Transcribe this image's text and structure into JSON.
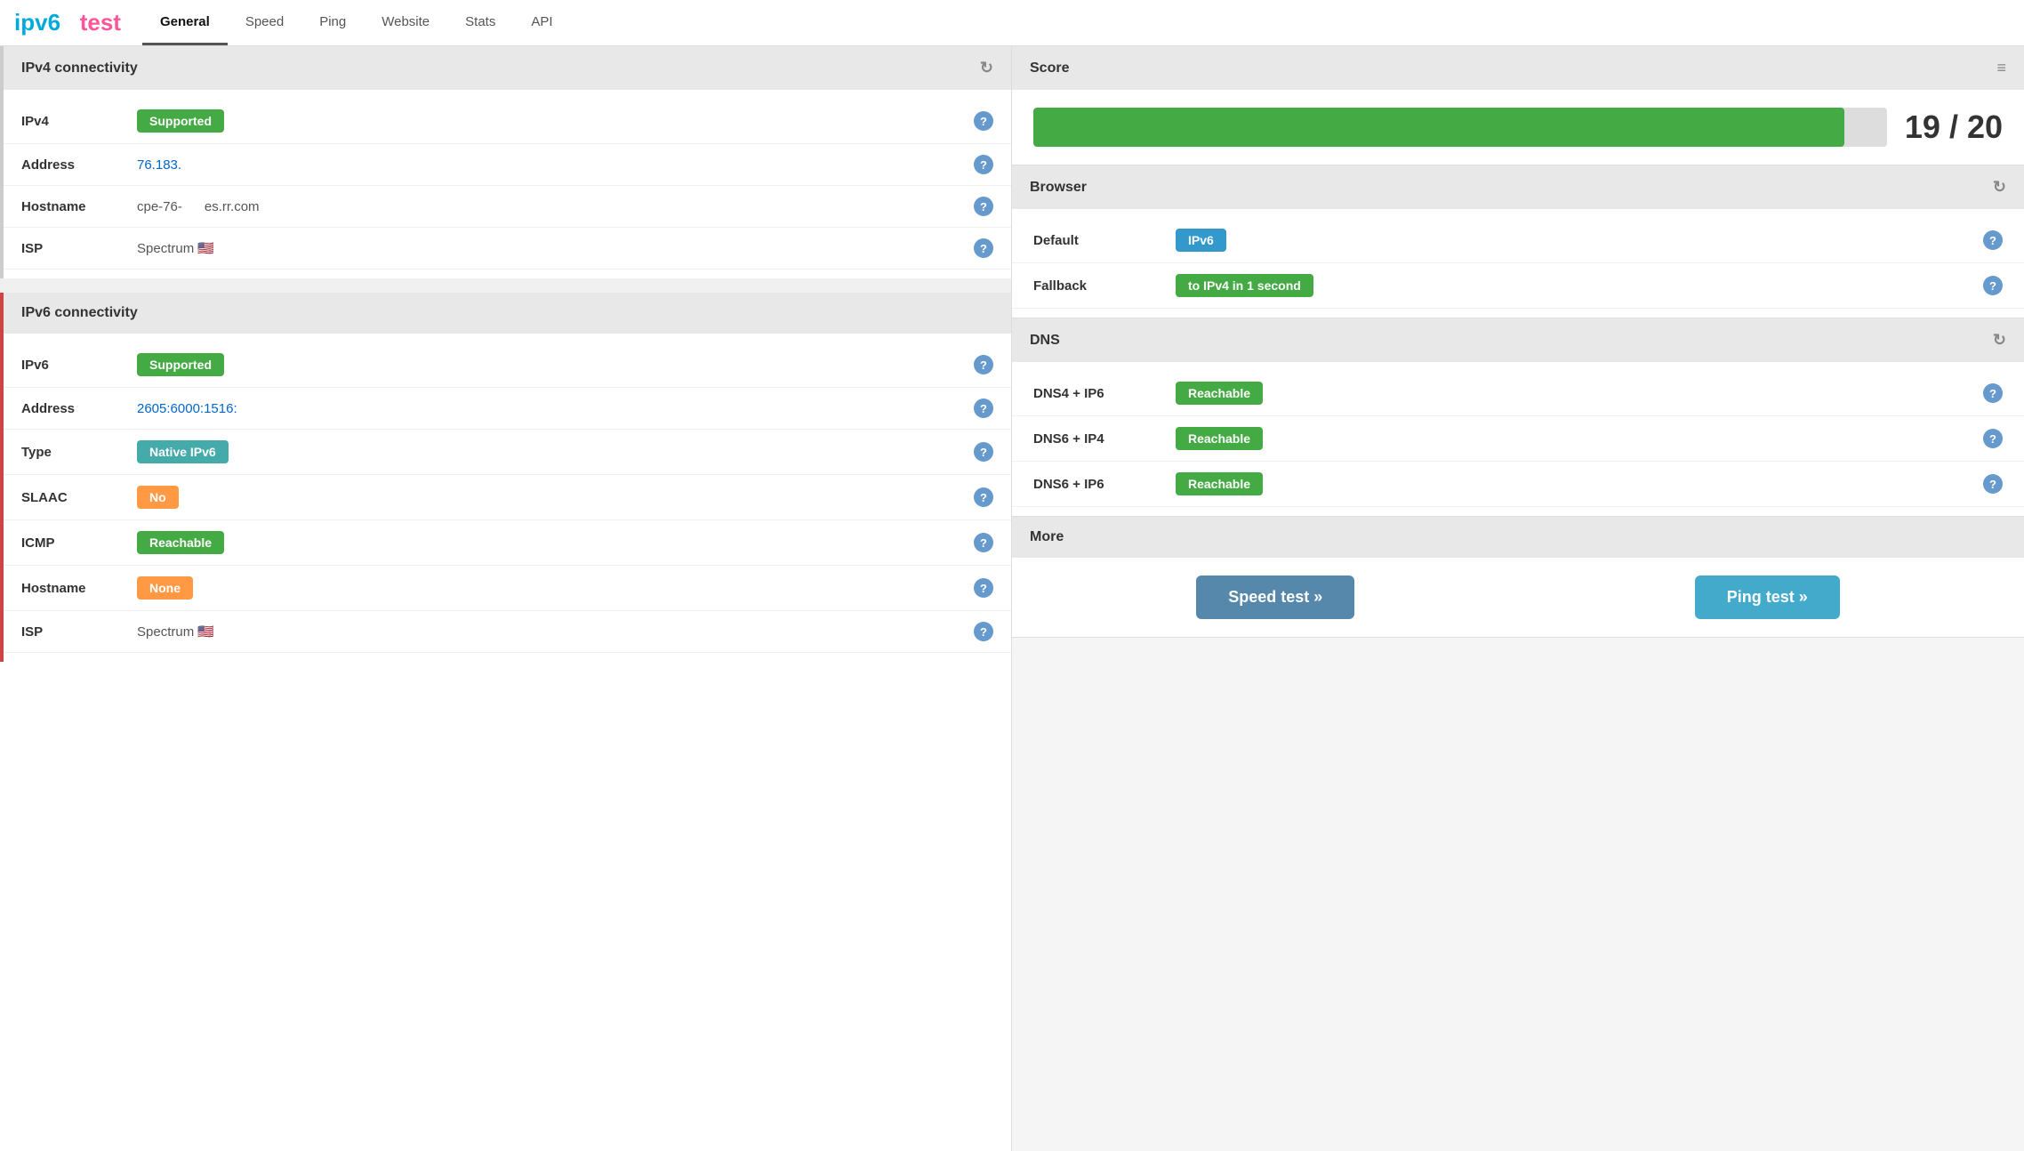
{
  "logo": {
    "ipv6": "ipv6",
    "test": "test"
  },
  "nav": {
    "items": [
      {
        "id": "general",
        "label": "General",
        "active": true
      },
      {
        "id": "speed",
        "label": "Speed",
        "active": false
      },
      {
        "id": "ping",
        "label": "Ping",
        "active": false
      },
      {
        "id": "website",
        "label": "Website",
        "active": false
      },
      {
        "id": "stats",
        "label": "Stats",
        "active": false
      },
      {
        "id": "api",
        "label": "API",
        "active": false
      }
    ]
  },
  "ipv4": {
    "section_title": "IPv4 connectivity",
    "rows": [
      {
        "label": "IPv4",
        "value": "",
        "badge": "Supported",
        "badge_type": "green"
      },
      {
        "label": "Address",
        "value": "76.183.",
        "is_link": true
      },
      {
        "label": "Hostname",
        "value": "cpe-76-",
        "value2": "es.rr.com"
      },
      {
        "label": "ISP",
        "value": "Spectrum 🇺🇸"
      }
    ]
  },
  "ipv6": {
    "section_title": "IPv6 connectivity",
    "rows": [
      {
        "label": "IPv6",
        "value": "",
        "badge": "Supported",
        "badge_type": "green"
      },
      {
        "label": "Address",
        "value": "2605:6000:1516:",
        "is_link": true
      },
      {
        "label": "Type",
        "value": "",
        "badge": "Native IPv6",
        "badge_type": "teal"
      },
      {
        "label": "SLAAC",
        "value": "",
        "badge": "No",
        "badge_type": "orange"
      },
      {
        "label": "ICMP",
        "value": "",
        "badge": "Reachable",
        "badge_type": "green"
      },
      {
        "label": "Hostname",
        "value": "",
        "badge": "None",
        "badge_type": "orange"
      },
      {
        "label": "ISP",
        "value": "Spectrum 🇺🇸"
      }
    ]
  },
  "score": {
    "section_title": "Score",
    "value": "19 / 20",
    "fill_percent": 95,
    "list_icon": "≡"
  },
  "browser": {
    "section_title": "Browser",
    "rows": [
      {
        "label": "Default",
        "badge": "IPv6",
        "badge_type": "blue"
      },
      {
        "label": "Fallback",
        "badge": "to IPv4 in 1 second",
        "badge_type": "green"
      }
    ]
  },
  "dns": {
    "section_title": "DNS",
    "rows": [
      {
        "label": "DNS4 + IP6",
        "badge": "Reachable",
        "badge_type": "green"
      },
      {
        "label": "DNS6 + IP4",
        "badge": "Reachable",
        "badge_type": "green"
      },
      {
        "label": "DNS6 + IP6",
        "badge": "Reachable",
        "badge_type": "green"
      }
    ]
  },
  "more": {
    "section_title": "More",
    "buttons": [
      {
        "label": "Speed test »",
        "type": "blue"
      },
      {
        "label": "Ping test »",
        "type": "teal"
      }
    ]
  }
}
